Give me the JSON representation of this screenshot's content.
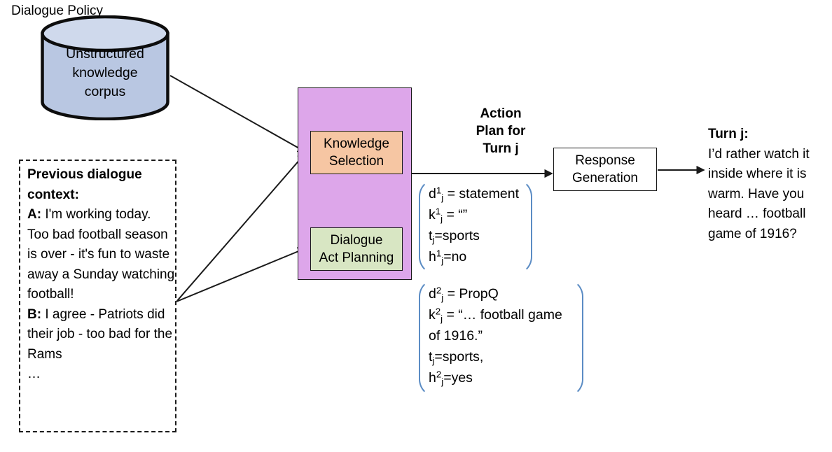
{
  "corpus": {
    "label": "Unstructured\nknowledge\ncorpus"
  },
  "dialogue_context": {
    "heading": "Previous dialogue context:",
    "turns": [
      {
        "speaker": "A:",
        "text": " I'm working today. Too bad football season is over - it's fun to waste away a Sunday watching football!"
      },
      {
        "speaker": "B:",
        "text": " I agree - Patriots did their job - too bad for the Rams"
      }
    ],
    "ellipsis": "…"
  },
  "policy": {
    "title": "Dialogue Policy",
    "knowledge_selection": "Knowledge\nSelection",
    "dialogue_act_planning": "Dialogue\nAct Planning"
  },
  "action_plan": {
    "title": "Action\nPlan for\nTurn j",
    "group1": {
      "d_sym": "d",
      "d_sup": "1",
      "d_sub": "j",
      "d_val": " = statement",
      "k_sym": "k",
      "k_sup": "1",
      "k_sub": "j",
      "k_val": " = “”",
      "t_sym": "t",
      "t_sub": "j",
      "t_val": "=sports",
      "h_sym": "h",
      "h_sup": "1",
      "h_sub": "j",
      "h_val": "=no"
    },
    "group2": {
      "d_sym": "d",
      "d_sup": "2",
      "d_sub": "j",
      "d_val": " = PropQ",
      "k_sym": "k",
      "k_sup": "2",
      "k_sub": "j",
      "k_val": " = “… football game of 1916.”",
      "t_sym": "t",
      "t_sub": "j",
      "t_val": "=sports,",
      "h_sym": "h",
      "h_sup": "2",
      "h_sub": "j",
      "h_val": "=yes"
    }
  },
  "response_generation": {
    "label": "Response\nGeneration"
  },
  "turn_output": {
    "heading": "Turn j:",
    "text": "I’d rather watch it inside where it is warm. Have you heard … football game of 1916?"
  },
  "colors": {
    "cylinder_fill": "#b9c7e2",
    "policy_fill": "#dda6ea",
    "knowledge_fill": "#f6c6a3",
    "act_fill": "#d8e6c3",
    "bracket": "#5b8cc4",
    "stroke": "#1a1a1a"
  }
}
